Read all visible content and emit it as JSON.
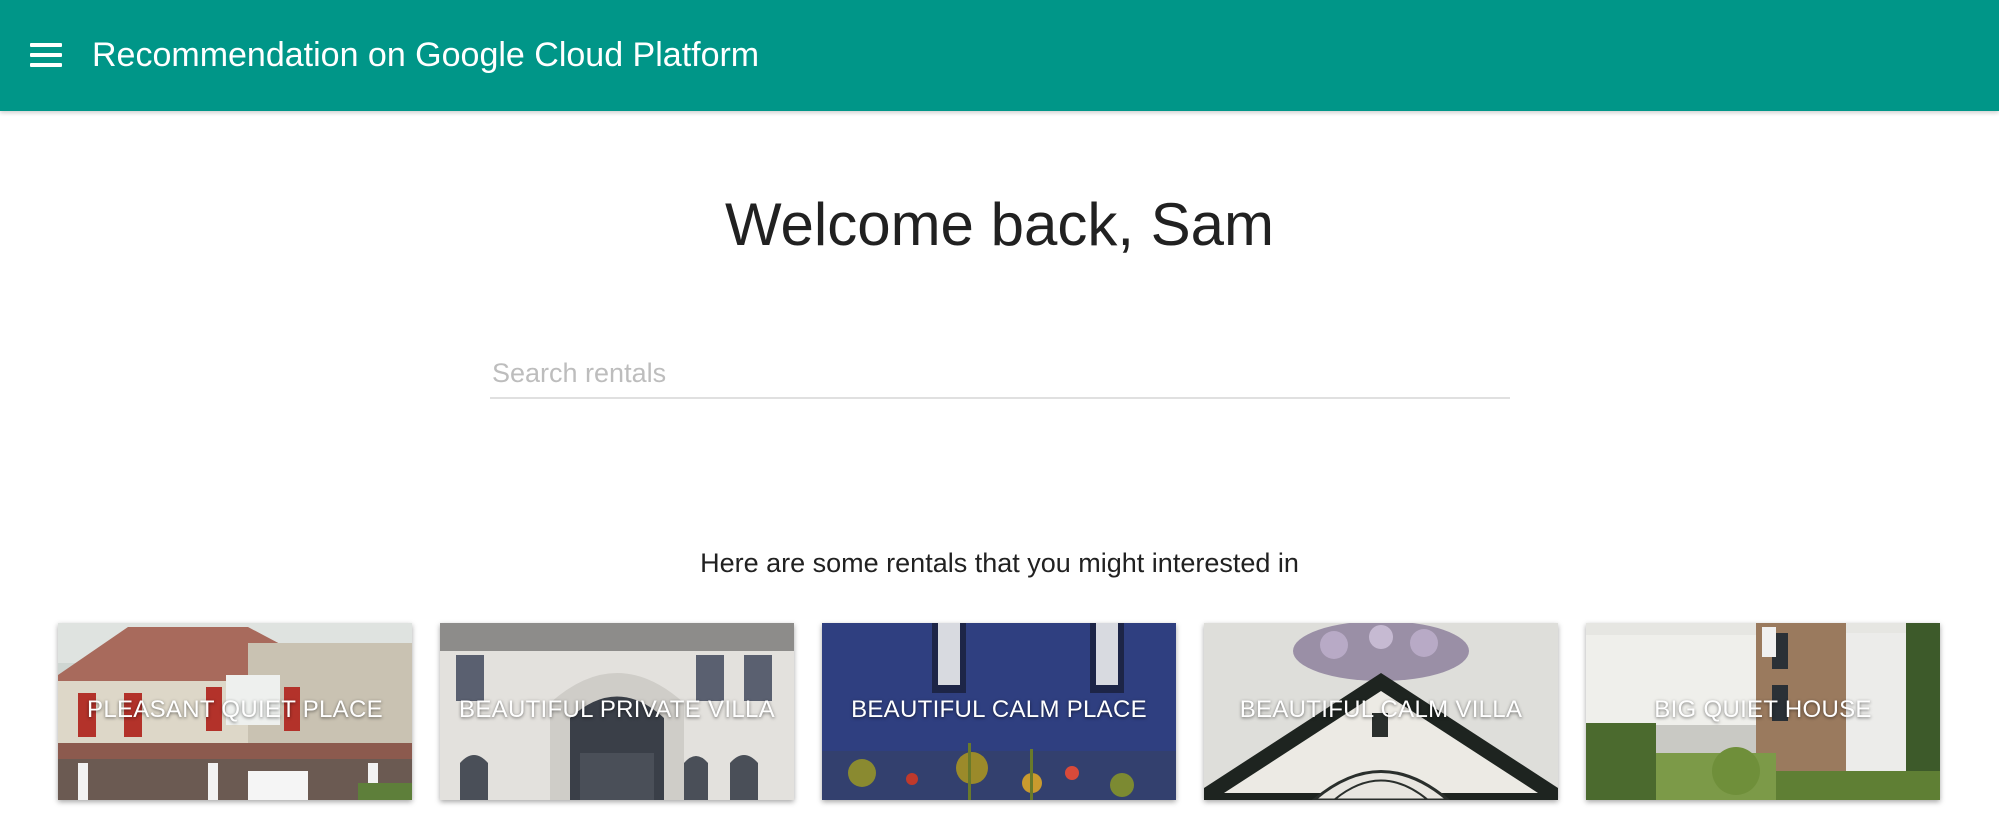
{
  "header": {
    "title": "Recommendation on Google Cloud Platform",
    "menu_icon": "hamburger-menu-icon",
    "background_color": "#009688"
  },
  "main": {
    "welcome": "Welcome back, Sam",
    "search": {
      "placeholder": "Search rentals",
      "value": ""
    },
    "recommendations_heading": "Here are some rentals that you might interested in",
    "rentals": [
      {
        "label": "PLEASANT QUIET PLACE",
        "image": "house-with-red-shutters"
      },
      {
        "label": "BEAUTIFUL PRIVATE VILLA",
        "image": "white-villa-facade"
      },
      {
        "label": "BEAUTIFUL CALM PLACE",
        "image": "blue-wall-with-flowers"
      },
      {
        "label": "BEAUTIFUL CALM VILLA",
        "image": "gable-with-flower-basket"
      },
      {
        "label": "BIG QUIET HOUSE",
        "image": "modern-house-with-garden"
      }
    ]
  }
}
